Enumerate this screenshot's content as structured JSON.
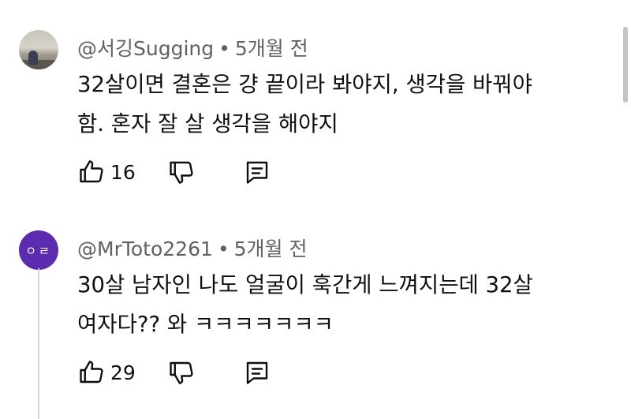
{
  "comments": [
    {
      "author": "@서깅Sugging",
      "separator": "•",
      "time": "5개월 전",
      "text_line1": "32살이면 결혼은 걍 끝이라 봐야지, 생각을 바꿔야",
      "text_line2": "함. 혼자 잘 살 생각을 해야지",
      "likes": "16",
      "avatar": {
        "type": "photo",
        "icon": "avatar-photo"
      }
    },
    {
      "author": "@MrToto2261",
      "separator": "•",
      "time": "5개월 전",
      "text_line1": "30살 남자인 나도 얼굴이 훅간게 느껴지는데 32살",
      "text_line2": "여자다?? 와 ㅋㅋㅋㅋㅋㅋㅋ",
      "likes": "29",
      "avatar": {
        "type": "letter",
        "letters": "ㅇㄹ",
        "color": "#5b2bb0"
      }
    }
  ],
  "icons": {
    "like": "thumbs-up-icon",
    "dislike": "thumbs-down-icon",
    "reply": "comment-reply-icon"
  }
}
